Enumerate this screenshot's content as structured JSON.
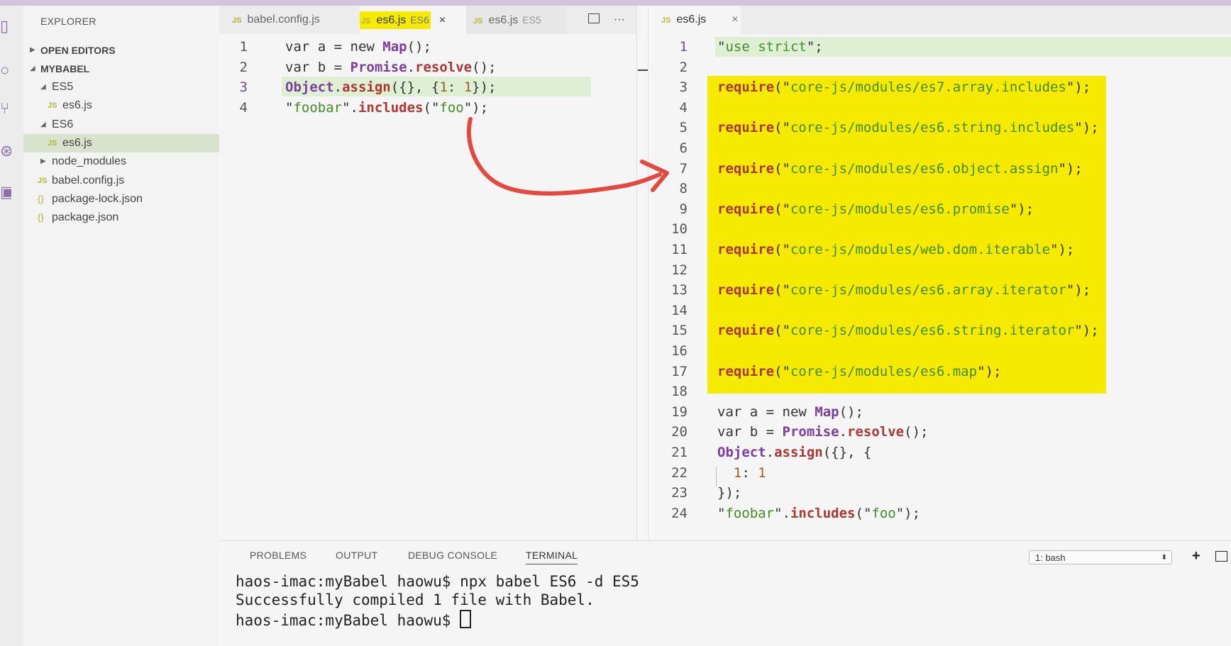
{
  "activity_bar": {
    "icons": [
      "files-icon",
      "search-icon",
      "source-control-icon",
      "debug-icon",
      "extensions-icon"
    ]
  },
  "sidebar": {
    "title": "EXPLORER",
    "open_editors": "OPEN EDITORS",
    "project": "MYBABEL",
    "tree": [
      {
        "label": "ES5",
        "type": "folder-open",
        "depth": 1
      },
      {
        "label": "es6.js",
        "type": "js",
        "depth": 2
      },
      {
        "label": "ES6",
        "type": "folder-open",
        "depth": 1
      },
      {
        "label": "es6.js",
        "type": "js",
        "depth": 2,
        "selected": true
      },
      {
        "label": "node_modules",
        "type": "folder-closed",
        "depth": 1
      },
      {
        "label": "babel.config.js",
        "type": "js",
        "depth": 1
      },
      {
        "label": "package-lock.json",
        "type": "json",
        "depth": 1
      },
      {
        "label": "package.json",
        "type": "json",
        "depth": 1
      }
    ],
    "js_badge": "JS",
    "json_badge": "{}"
  },
  "editor_left": {
    "tabs": [
      {
        "label": "babel.config.js",
        "desc": ""
      },
      {
        "label": "es6.js",
        "desc": "ES6",
        "active": true
      },
      {
        "label": "es6.js",
        "desc": "ES5"
      }
    ],
    "close_glyph": "×",
    "split_icon": "split-editor-icon",
    "more_glyph": "···",
    "lines": [
      {
        "n": "1",
        "tokens": [
          [
            "kw",
            "var a = new "
          ],
          [
            "cls",
            "Map"
          ],
          [
            "kw",
            "();"
          ]
        ]
      },
      {
        "n": "2",
        "tokens": [
          [
            "kw",
            "var b = "
          ],
          [
            "cls",
            "Promise"
          ],
          [
            "kw",
            "."
          ],
          [
            "fn",
            "resolve"
          ],
          [
            "kw",
            "();"
          ]
        ]
      },
      {
        "n": "3",
        "tokens": [
          [
            "cls",
            "Object"
          ],
          [
            "kw",
            "."
          ],
          [
            "fn",
            "assign"
          ],
          [
            "kw",
            "({}, {"
          ],
          [
            "num",
            "1"
          ],
          [
            "kw",
            ": "
          ],
          [
            "num",
            "1"
          ],
          [
            "kw",
            "});"
          ]
        ]
      },
      {
        "n": "4",
        "tokens": [
          [
            "kw",
            "\""
          ],
          [
            "str",
            "foobar"
          ],
          [
            "kw",
            "\"."
          ],
          [
            "fn",
            "includes"
          ],
          [
            "kw",
            "(\""
          ],
          [
            "str",
            "foo"
          ],
          [
            "kw",
            "\");"
          ]
        ]
      }
    ]
  },
  "editor_right": {
    "tab": {
      "label": "es6.js"
    },
    "close_glyph": "×",
    "lines": [
      {
        "n": "1",
        "tokens": [
          [
            "kw",
            "\""
          ],
          [
            "str",
            "use strict"
          ],
          [
            "kw",
            "\";"
          ]
        ]
      },
      {
        "n": "2",
        "tokens": []
      },
      {
        "n": "3",
        "tokens": [
          [
            "req",
            "require"
          ],
          [
            "kw",
            "(\""
          ],
          [
            "str",
            "core-js/modules/es7.array.includes"
          ],
          [
            "kw",
            "\");"
          ]
        ]
      },
      {
        "n": "4",
        "tokens": []
      },
      {
        "n": "5",
        "tokens": [
          [
            "req",
            "require"
          ],
          [
            "kw",
            "(\""
          ],
          [
            "str",
            "core-js/modules/es6.string.includes"
          ],
          [
            "kw",
            "\");"
          ]
        ]
      },
      {
        "n": "6",
        "tokens": []
      },
      {
        "n": "7",
        "tokens": [
          [
            "req",
            "require"
          ],
          [
            "kw",
            "(\""
          ],
          [
            "str",
            "core-js/modules/es6.object.assign"
          ],
          [
            "kw",
            "\");"
          ]
        ]
      },
      {
        "n": "8",
        "tokens": []
      },
      {
        "n": "9",
        "tokens": [
          [
            "req",
            "require"
          ],
          [
            "kw",
            "(\""
          ],
          [
            "str",
            "core-js/modules/es6.promise"
          ],
          [
            "kw",
            "\");"
          ]
        ]
      },
      {
        "n": "10",
        "tokens": []
      },
      {
        "n": "11",
        "tokens": [
          [
            "req",
            "require"
          ],
          [
            "kw",
            "(\""
          ],
          [
            "str",
            "core-js/modules/web.dom.iterable"
          ],
          [
            "kw",
            "\");"
          ]
        ]
      },
      {
        "n": "12",
        "tokens": []
      },
      {
        "n": "13",
        "tokens": [
          [
            "req",
            "require"
          ],
          [
            "kw",
            "(\""
          ],
          [
            "str",
            "core-js/modules/es6.array.iterator"
          ],
          [
            "kw",
            "\");"
          ]
        ]
      },
      {
        "n": "14",
        "tokens": []
      },
      {
        "n": "15",
        "tokens": [
          [
            "req",
            "require"
          ],
          [
            "kw",
            "(\""
          ],
          [
            "str",
            "core-js/modules/es6.string.iterator"
          ],
          [
            "kw",
            "\");"
          ]
        ]
      },
      {
        "n": "16",
        "tokens": []
      },
      {
        "n": "17",
        "tokens": [
          [
            "req",
            "require"
          ],
          [
            "kw",
            "(\""
          ],
          [
            "str",
            "core-js/modules/es6.map"
          ],
          [
            "kw",
            "\");"
          ]
        ]
      },
      {
        "n": "18",
        "tokens": []
      },
      {
        "n": "19",
        "tokens": [
          [
            "kw",
            "var a = new "
          ],
          [
            "cls",
            "Map"
          ],
          [
            "kw",
            "();"
          ]
        ]
      },
      {
        "n": "20",
        "tokens": [
          [
            "kw",
            "var b = "
          ],
          [
            "cls",
            "Promise"
          ],
          [
            "kw",
            "."
          ],
          [
            "fn",
            "resolve"
          ],
          [
            "kw",
            "();"
          ]
        ]
      },
      {
        "n": "21",
        "tokens": [
          [
            "cls",
            "Object"
          ],
          [
            "kw",
            "."
          ],
          [
            "fn",
            "assign"
          ],
          [
            "kw",
            "({}, {"
          ]
        ]
      },
      {
        "n": "22",
        "tokens": [
          [
            "kw",
            "  "
          ],
          [
            "num",
            "1"
          ],
          [
            "kw",
            ": "
          ],
          [
            "num",
            "1"
          ]
        ]
      },
      {
        "n": "23",
        "tokens": [
          [
            "kw",
            "});"
          ]
        ]
      },
      {
        "n": "24",
        "tokens": [
          [
            "kw",
            "\""
          ],
          [
            "str",
            "foobar"
          ],
          [
            "kw",
            "\"."
          ],
          [
            "fn",
            "includes"
          ],
          [
            "kw",
            "(\""
          ],
          [
            "str",
            "foo"
          ],
          [
            "kw",
            "\");"
          ]
        ]
      }
    ]
  },
  "panel": {
    "tabs": [
      "PROBLEMS",
      "OUTPUT",
      "DEBUG CONSOLE",
      "TERMINAL"
    ],
    "active_tab": "TERMINAL",
    "shell_select": "1: bash",
    "add_glyph": "+",
    "split_icon": "split-terminal-icon",
    "terminal_lines": [
      "haos-imac:myBabel haowu$ npx babel ES6 -d ES5",
      "Successfully compiled 1 file with Babel.",
      "haos-imac:myBabel haowu$ "
    ]
  },
  "colors": {
    "highlight": "#f5ea00",
    "arrow": "#e4493f",
    "current_line": "#dfefd4",
    "selection": "#d8e2cc"
  }
}
